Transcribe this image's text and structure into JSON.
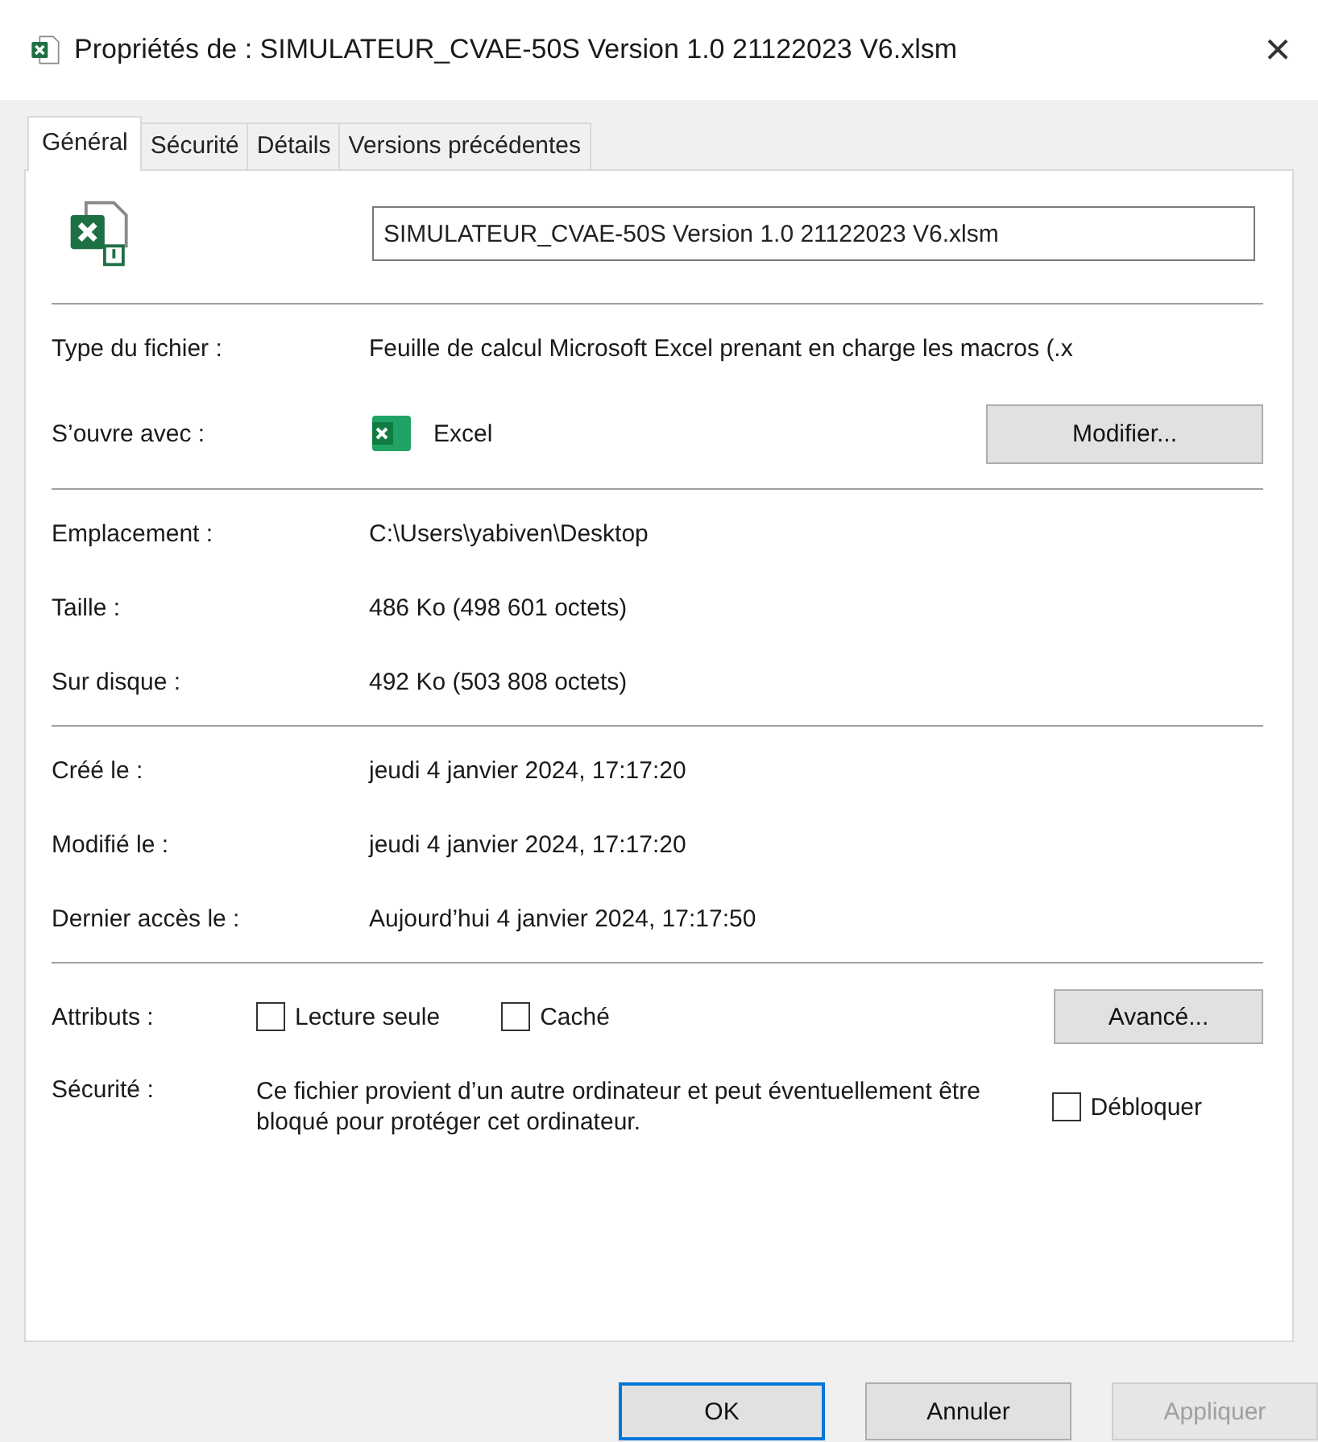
{
  "window": {
    "title": "Propriétés de : SIMULATEUR_CVAE-50S Version 1.0 21122023 V6.xlsm",
    "close": "×"
  },
  "tabs": [
    {
      "label": "Général",
      "selected": true
    },
    {
      "label": "Sécurité",
      "selected": false
    },
    {
      "label": "Détails",
      "selected": false
    },
    {
      "label": "Versions précédentes",
      "selected": false
    }
  ],
  "file_name": {
    "value": "SIMULATEUR_CVAE-50S Version 1.0 21122023 V6.xlsm"
  },
  "file_type": {
    "label": "Type du fichier :",
    "value": "Feuille de calcul Microsoft Excel prenant en charge les macros (.x"
  },
  "opens_with": {
    "label": "S’ouvre avec :",
    "app": "Excel",
    "button": "Modifier..."
  },
  "location_rows": [
    {
      "label": "Emplacement :",
      "value": "C:\\Users\\yabiven\\Desktop"
    },
    {
      "label": "Taille :",
      "value": "486 Ko (498 601 octets)"
    },
    {
      "label": "Sur disque :",
      "value": "492 Ko (503 808 octets)"
    }
  ],
  "date_rows": [
    {
      "label": "Créé le :",
      "value": "jeudi 4 janvier 2024, 17:17:20"
    },
    {
      "label": "Modifié le :",
      "value": "jeudi 4 janvier 2024, 17:17:20"
    },
    {
      "label": "Dernier accès le :",
      "value": "Aujourd’hui 4 janvier 2024, 17:17:50"
    }
  ],
  "attributes": {
    "label": "Attributs :",
    "checkboxes": [
      {
        "label": "Lecture seule",
        "checked": false
      },
      {
        "label": "Caché",
        "checked": false
      }
    ],
    "button": "Avancé..."
  },
  "security": {
    "label": "Sécurité :",
    "text": "Ce fichier provient d’un autre ordinateur et peut éventuellement être bloqué pour protéger cet ordinateur.",
    "checkbox": {
      "label": "Débloquer",
      "checked": false
    }
  },
  "buttons": [
    {
      "label": "OK",
      "default": true,
      "disabled": false
    },
    {
      "label": "Annuler",
      "default": false,
      "disabled": false
    },
    {
      "label": "Appliquer",
      "default": false,
      "disabled": true
    }
  ]
}
